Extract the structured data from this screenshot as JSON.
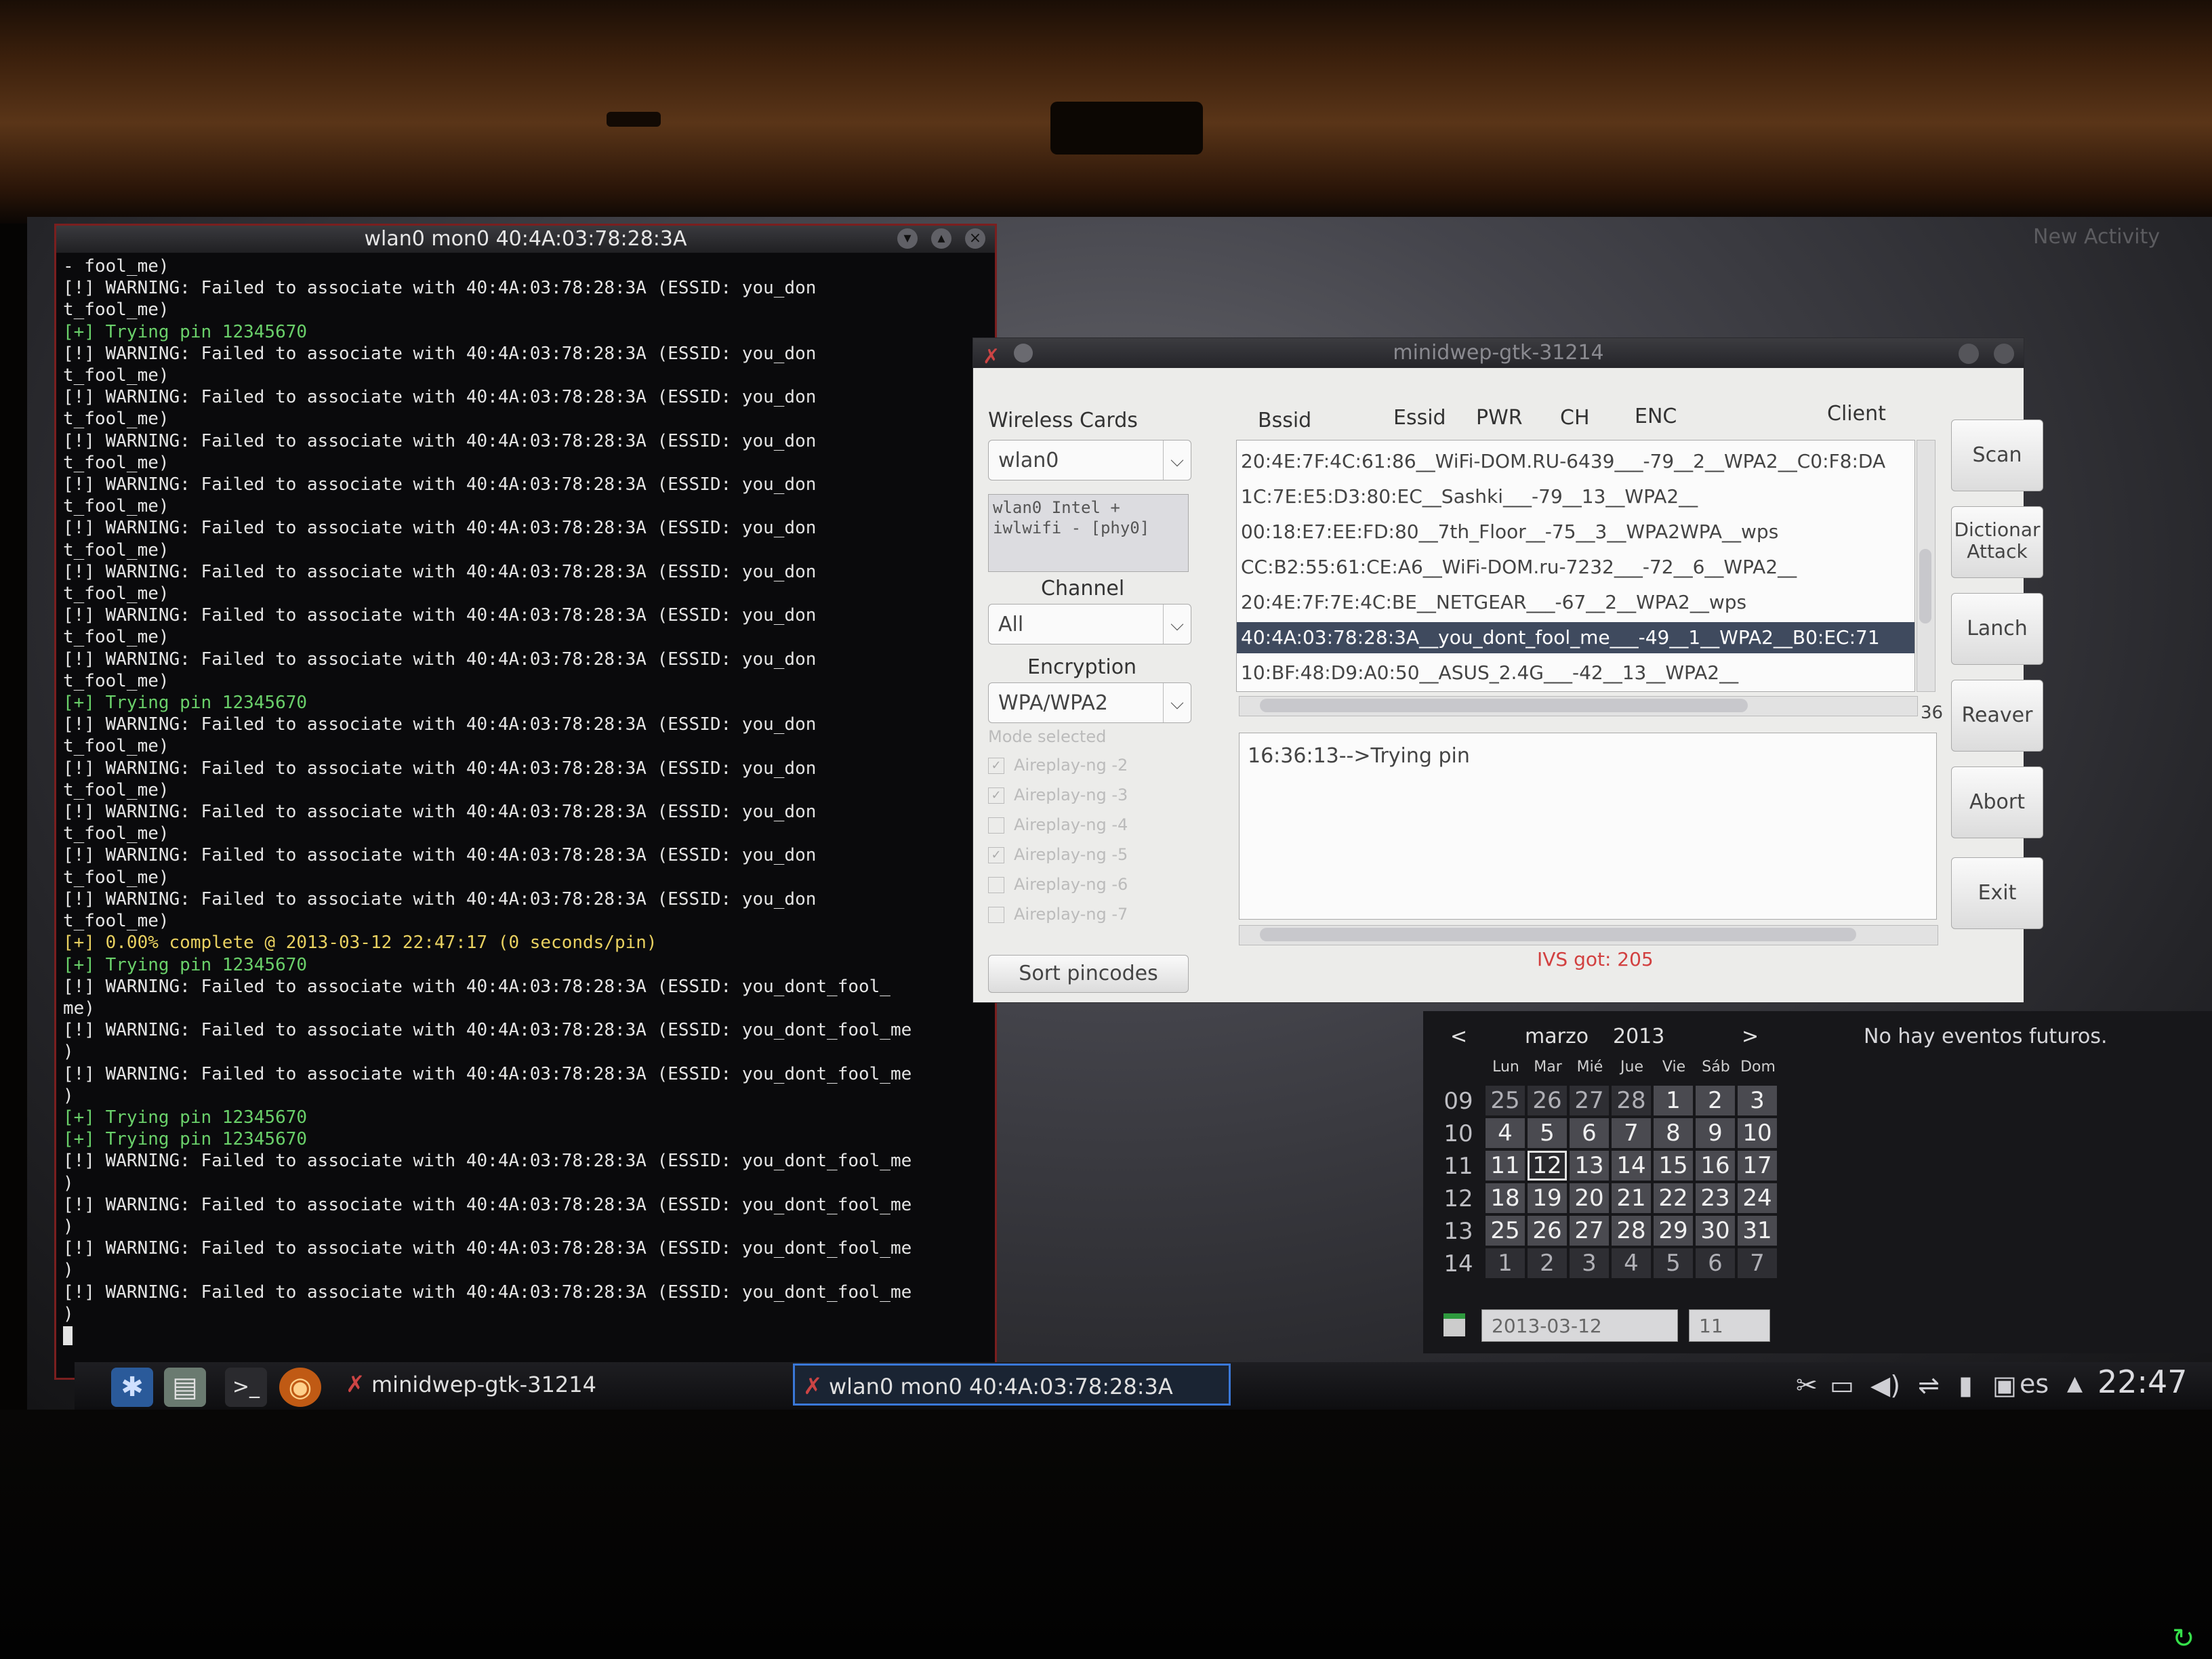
{
  "desktop": {
    "new_activity": "New Activity"
  },
  "terminal": {
    "title": "wlan0 mon0 40:4A:03:78:28:3A",
    "lines": [
      {
        "t": "- fool_me)",
        "k": "w"
      },
      {
        "t": "[!] WARNING: Failed to associate with 40:4A:03:78:28:3A (ESSID: you_don",
        "k": "w"
      },
      {
        "t": "t_fool_me)",
        "k": "w"
      },
      {
        "t": "[+] Trying pin 12345670",
        "k": "g"
      },
      {
        "t": "[!] WARNING: Failed to associate with 40:4A:03:78:28:3A (ESSID: you_don",
        "k": "w"
      },
      {
        "t": "t_fool_me)",
        "k": "w"
      },
      {
        "t": "[!] WARNING: Failed to associate with 40:4A:03:78:28:3A (ESSID: you_don",
        "k": "w"
      },
      {
        "t": "t_fool_me)",
        "k": "w"
      },
      {
        "t": "[!] WARNING: Failed to associate with 40:4A:03:78:28:3A (ESSID: you_don",
        "k": "w"
      },
      {
        "t": "t_fool_me)",
        "k": "w"
      },
      {
        "t": "[!] WARNING: Failed to associate with 40:4A:03:78:28:3A (ESSID: you_don",
        "k": "w"
      },
      {
        "t": "t_fool_me)",
        "k": "w"
      },
      {
        "t": "[!] WARNING: Failed to associate with 40:4A:03:78:28:3A (ESSID: you_don",
        "k": "w"
      },
      {
        "t": "t_fool_me)",
        "k": "w"
      },
      {
        "t": "[!] WARNING: Failed to associate with 40:4A:03:78:28:3A (ESSID: you_don",
        "k": "w"
      },
      {
        "t": "t_fool_me)",
        "k": "w"
      },
      {
        "t": "[!] WARNING: Failed to associate with 40:4A:03:78:28:3A (ESSID: you_don",
        "k": "w"
      },
      {
        "t": "t_fool_me)",
        "k": "w"
      },
      {
        "t": "[!] WARNING: Failed to associate with 40:4A:03:78:28:3A (ESSID: you_don",
        "k": "w"
      },
      {
        "t": "t_fool_me)",
        "k": "w"
      },
      {
        "t": "[+] Trying pin 12345670",
        "k": "g"
      },
      {
        "t": "[!] WARNING: Failed to associate with 40:4A:03:78:28:3A (ESSID: you_don",
        "k": "w"
      },
      {
        "t": "t_fool_me)",
        "k": "w"
      },
      {
        "t": "[!] WARNING: Failed to associate with 40:4A:03:78:28:3A (ESSID: you_don",
        "k": "w"
      },
      {
        "t": "t_fool_me)",
        "k": "w"
      },
      {
        "t": "[!] WARNING: Failed to associate with 40:4A:03:78:28:3A (ESSID: you_don",
        "k": "w"
      },
      {
        "t": "t_fool_me)",
        "k": "w"
      },
      {
        "t": "[!] WARNING: Failed to associate with 40:4A:03:78:28:3A (ESSID: you_don",
        "k": "w"
      },
      {
        "t": "t_fool_me)",
        "k": "w"
      },
      {
        "t": "[!] WARNING: Failed to associate with 40:4A:03:78:28:3A (ESSID: you_don",
        "k": "w"
      },
      {
        "t": "t_fool_me)",
        "k": "w"
      },
      {
        "t": "[+] 0.00% complete @ 2013-03-12 22:47:17 (0 seconds/pin)",
        "k": "y"
      },
      {
        "t": "[+] Trying pin 12345670",
        "k": "g"
      },
      {
        "t": "[!] WARNING: Failed to associate with 40:4A:03:78:28:3A (ESSID: you_dont_fool_",
        "k": "w"
      },
      {
        "t": "me)",
        "k": "w"
      },
      {
        "t": "[!] WARNING: Failed to associate with 40:4A:03:78:28:3A (ESSID: you_dont_fool_me",
        "k": "w"
      },
      {
        "t": ")",
        "k": "w"
      },
      {
        "t": "[!] WARNING: Failed to associate with 40:4A:03:78:28:3A (ESSID: you_dont_fool_me",
        "k": "w"
      },
      {
        "t": ")",
        "k": "w"
      },
      {
        "t": "[+] Trying pin 12345670",
        "k": "g"
      },
      {
        "t": "[+] Trying pin 12345670",
        "k": "g"
      },
      {
        "t": "[!] WARNING: Failed to associate with 40:4A:03:78:28:3A (ESSID: you_dont_fool_me",
        "k": "w"
      },
      {
        "t": ")",
        "k": "w"
      },
      {
        "t": "[!] WARNING: Failed to associate with 40:4A:03:78:28:3A (ESSID: you_dont_fool_me",
        "k": "w"
      },
      {
        "t": ")",
        "k": "w"
      },
      {
        "t": "[!] WARNING: Failed to associate with 40:4A:03:78:28:3A (ESSID: you_dont_fool_me",
        "k": "w"
      },
      {
        "t": ")",
        "k": "w"
      },
      {
        "t": "[!] WARNING: Failed to associate with 40:4A:03:78:28:3A (ESSID: you_dont_fool_me",
        "k": "w"
      },
      {
        "t": ")",
        "k": "w"
      }
    ]
  },
  "minidwep": {
    "title": "minidwep-gtk-31214",
    "wireless_cards_label": "Wireless Cards",
    "card_value": "wlan0",
    "card_info": "wlan0 Intel + iwlwifi - [phy0]",
    "channel_label": "Channel",
    "channel_value": "All",
    "encryption_label": "Encryption",
    "encryption_value": "WPA/WPA2",
    "mode_label": "Mode selected",
    "modes": [
      {
        "label": "Aireplay-ng -2",
        "checked": true
      },
      {
        "label": "Aireplay-ng -3",
        "checked": true
      },
      {
        "label": "Aireplay-ng -4",
        "checked": false
      },
      {
        "label": "Aireplay-ng -5",
        "checked": true
      },
      {
        "label": "Aireplay-ng -6",
        "checked": false
      },
      {
        "label": "Aireplay-ng -7",
        "checked": false
      }
    ],
    "sort_pincodes": "Sort pincodes",
    "columns": {
      "bssid": "Bssid",
      "essid": "Essid",
      "pwr": "PWR",
      "ch": "CH",
      "enc": "ENC",
      "client": "Client"
    },
    "ap_rows": [
      "20:4E:7F:4C:61:86__WiFi-DOM.RU-6439___-79__2__WPA2__C0:F8:DA",
      "1C:7E:E5:D3:80:EC__Sashki___-79__13__WPA2__",
      "00:18:E7:EE:FD:80__7th_Floor__-75__3__WPA2WPA__wps",
      "CC:B2:55:61:CE:A6__WiFi-DOM.ru-7232___-72__6__WPA2__",
      "20:4E:7F:7E:4C:BE__NETGEAR___-67__2__WPA2__wps",
      "40:4A:03:78:28:3A__you_dont_fool_me___-49__1__WPA2__B0:EC:71",
      "10:BF:48:D9:A0:50__ASUS_2.4G___-42__13__WPA2__"
    ],
    "selected_row": 5,
    "ap_count": "36",
    "log_text": "16:36:13-->Trying pin",
    "ivs_text": "IVS got: 205",
    "buttons": {
      "scan": "Scan",
      "dict": "Dictionar Attack",
      "lanch": "Lanch",
      "reaver": "Reaver",
      "abort": "Abort",
      "exit": "Exit"
    }
  },
  "calendar": {
    "prev": "<",
    "next": ">",
    "month": "marzo",
    "year": "2013",
    "dow": [
      "Lun",
      "Mar",
      "Mié",
      "Jue",
      "Vie",
      "Sáb",
      "Dom"
    ],
    "weeks": [
      {
        "wk": "09",
        "days": [
          [
            "25",
            1
          ],
          [
            "26",
            1
          ],
          [
            "27",
            1
          ],
          [
            "28",
            1
          ],
          [
            "1",
            0
          ],
          [
            "2",
            0
          ],
          [
            "3",
            0
          ]
        ]
      },
      {
        "wk": "10",
        "days": [
          [
            "4",
            0
          ],
          [
            "5",
            0
          ],
          [
            "6",
            0
          ],
          [
            "7",
            0
          ],
          [
            "8",
            0
          ],
          [
            "9",
            0
          ],
          [
            "10",
            0
          ]
        ]
      },
      {
        "wk": "11",
        "days": [
          [
            "11",
            0
          ],
          [
            "12",
            2
          ],
          [
            "13",
            0
          ],
          [
            "14",
            0
          ],
          [
            "15",
            0
          ],
          [
            "16",
            0
          ],
          [
            "17",
            0
          ]
        ]
      },
      {
        "wk": "12",
        "days": [
          [
            "18",
            0
          ],
          [
            "19",
            0
          ],
          [
            "20",
            0
          ],
          [
            "21",
            0
          ],
          [
            "22",
            0
          ],
          [
            "23",
            0
          ],
          [
            "24",
            0
          ]
        ]
      },
      {
        "wk": "13",
        "days": [
          [
            "25",
            0
          ],
          [
            "26",
            0
          ],
          [
            "27",
            0
          ],
          [
            "28",
            0
          ],
          [
            "29",
            0
          ],
          [
            "30",
            0
          ],
          [
            "31",
            0
          ]
        ]
      },
      {
        "wk": "14",
        "days": [
          [
            "1",
            1
          ],
          [
            "2",
            1
          ],
          [
            "3",
            1
          ],
          [
            "4",
            1
          ],
          [
            "5",
            1
          ],
          [
            "6",
            1
          ],
          [
            "7",
            1
          ]
        ]
      }
    ],
    "no_events": "No hay eventos futuros.",
    "date_field": "2013-03-12",
    "week_field": "11"
  },
  "taskbar": {
    "tasks": [
      {
        "label": "minidwep-gtk-31214",
        "active": false
      },
      {
        "label": "wlan0 mon0 40:4A:03:78:28:3A",
        "active": true
      }
    ],
    "lang": "es",
    "clock": "22:47"
  }
}
